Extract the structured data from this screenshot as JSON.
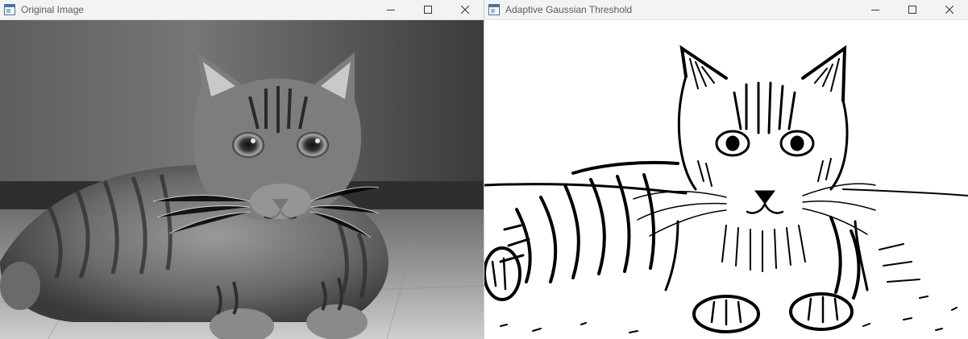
{
  "windows": [
    {
      "title": "Original Image",
      "controls": {
        "minimize": "minimize-icon",
        "maximize": "maximize-icon",
        "close": "close-icon"
      },
      "content": {
        "description_icon": "grayscale-cat-photo",
        "theme": "grayscale"
      }
    },
    {
      "title": "Adaptive Gaussian Threshold",
      "controls": {
        "minimize": "minimize-icon",
        "maximize": "maximize-icon",
        "close": "close-icon"
      },
      "content": {
        "description_icon": "binary-threshold-cat-image",
        "theme": "black-and-white"
      }
    }
  ],
  "colors": {
    "titlebar": "#f3f3f3",
    "title_text": "#5b5b5b",
    "photo_dark": "#2b2b2b",
    "photo_mid": "#7a7a7a",
    "photo_light": "#d9d9d9"
  }
}
